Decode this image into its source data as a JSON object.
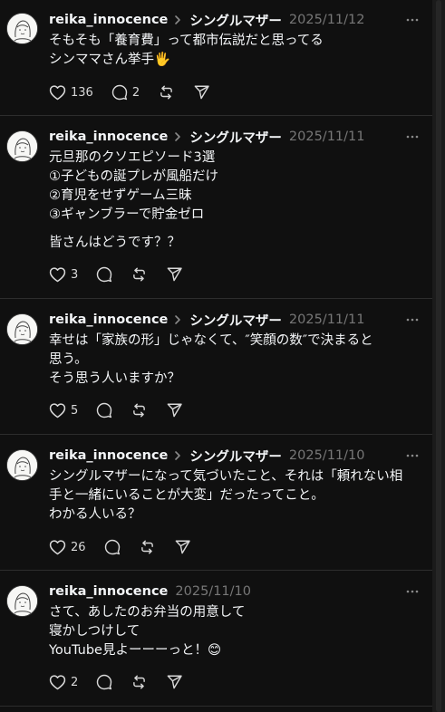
{
  "feed": {
    "posts": [
      {
        "username": "reika_innocence",
        "topic": "シングルマザー",
        "date": "2025/11/12",
        "lines": [
          "そもそも「養育費」って都市伝説だと思ってる",
          "シンママさん挙手🖐"
        ],
        "likes": "136",
        "replies": "2"
      },
      {
        "username": "reika_innocence",
        "topic": "シングルマザー",
        "date": "2025/11/11",
        "lines": [
          "元旦那のクソエピソード3選",
          "①子どもの誕プレが風船だけ",
          "②育児をせずゲーム三昧",
          "③ギャンブラーで貯金ゼロ",
          "",
          "皆さんはどうです？？"
        ],
        "likes": "3",
        "replies": ""
      },
      {
        "username": "reika_innocence",
        "topic": "シングルマザー",
        "date": "2025/11/11",
        "lines": [
          "幸せは「家族の形」じゃなくて、″笑顔の数″で決まると",
          "思う。",
          "そう思う人いますか？"
        ],
        "likes": "5",
        "replies": ""
      },
      {
        "username": "reika_innocence",
        "topic": "シングルマザー",
        "date": "2025/11/10",
        "lines": [
          "シングルマザーになって気づいたこと、それは「頼れない相",
          "手と一緒にいることが大変」だったってこと。",
          "わかる人いる？"
        ],
        "likes": "26",
        "replies": ""
      },
      {
        "username": "reika_innocence",
        "topic": "",
        "date": "2025/11/10",
        "lines": [
          "さて、あしたのお弁当の用意して",
          "寝かしつけして",
          "YouTube見よーーーっと！😊"
        ],
        "likes": "2",
        "replies": ""
      }
    ]
  },
  "icons": {
    "like": "heart-icon",
    "reply": "comment-icon",
    "repost": "repost-icon",
    "share": "send-icon",
    "more": "more-dots-icon",
    "separator": "chevron-right-icon"
  },
  "colors": {
    "background": "#101010",
    "text": "#f3f5f7",
    "muted": "#777777",
    "divider": "#2d2d2d"
  }
}
